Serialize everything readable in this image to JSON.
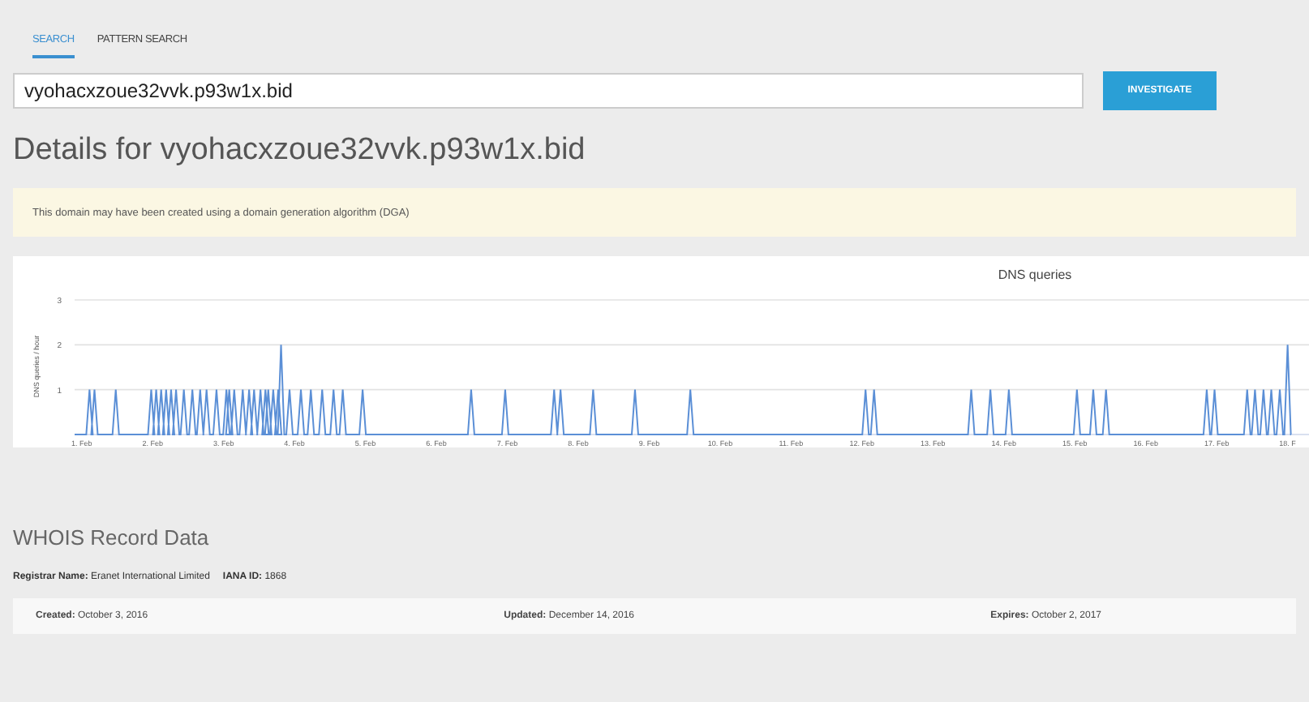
{
  "tabs": [
    {
      "label": "SEARCH",
      "selected": true
    },
    {
      "label": "PATTERN SEARCH",
      "selected": false
    }
  ],
  "search": {
    "value": "vyohacxzoue32vvk.p93w1x.bid",
    "button": "INVESTIGATE"
  },
  "heading": "Details for vyohacxzoue32vvk.p93w1x.bid",
  "alert": "This domain may have been created using a domain generation algorithm (DGA)",
  "chart": {
    "title": "DNS queries",
    "ylabel": "DNS queries / hour",
    "yticks": [
      "3",
      "2",
      "1"
    ],
    "xlabels": [
      "1. Feb",
      "2. Feb",
      "3. Feb",
      "4. Feb",
      "5. Feb",
      "6. Feb",
      "7. Feb",
      "8. Feb",
      "9. Feb",
      "10. Feb",
      "11. Feb",
      "12. Feb",
      "13. Feb",
      "14. Feb",
      "15. Feb",
      "16. Feb",
      "17. Feb",
      "18. F"
    ]
  },
  "whois": {
    "title": "WHOIS Record Data",
    "registrar": [
      {
        "label": "Registrar Name:",
        "value": "Eranet International Limited"
      },
      {
        "label": "IANA ID:",
        "value": "1868"
      }
    ],
    "dates": [
      {
        "label": "Created:",
        "value": "October 3, 2016"
      },
      {
        "label": "Updated:",
        "value": "December 14, 2016"
      },
      {
        "label": "Expires:",
        "value": "October 2, 2017"
      }
    ]
  }
}
